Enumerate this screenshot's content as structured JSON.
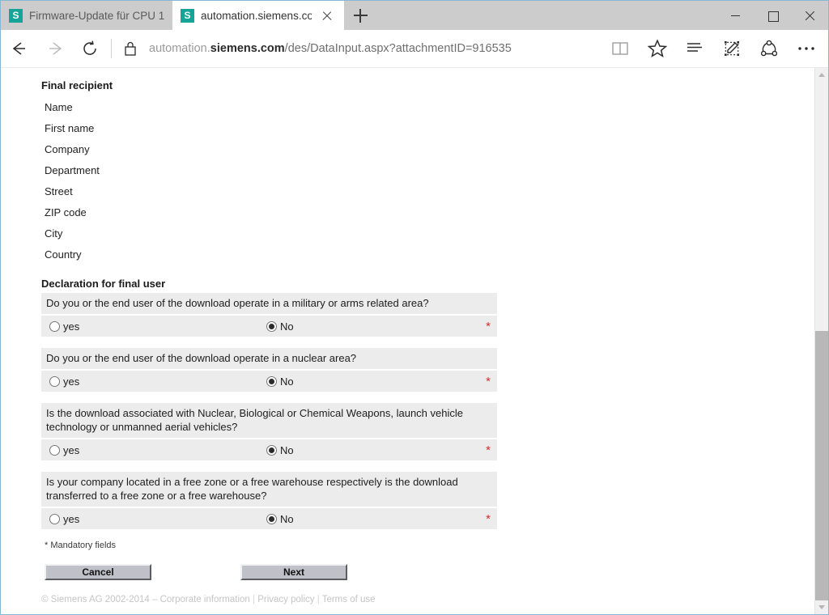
{
  "browser": {
    "tabs": [
      {
        "favicon_letter": "S",
        "title": "Firmware-Update für CPU 1",
        "active": false
      },
      {
        "favicon_letter": "S",
        "title": "automation.siemens.cor",
        "active": true
      }
    ],
    "new_tab_label": "+",
    "window_controls": {
      "minimize": "Minimize",
      "maximize": "Maximize",
      "close": "Close"
    },
    "toolbar": {
      "back_label": "Back",
      "forward_label": "Forward",
      "refresh_label": "Refresh",
      "security_label": "Secure connection",
      "url_host": "automation.",
      "url_domain": "siemens.com",
      "url_path": "/des/DataInput.aspx?attachmentID=916535",
      "reading_view_label": "Reading view",
      "web_note_label": "Make a Web Note",
      "share_label": "Share",
      "more_label": "More"
    }
  },
  "page": {
    "recipient": {
      "heading": "Final recipient",
      "fields": [
        {
          "label": "Name"
        },
        {
          "label": "First name"
        },
        {
          "label": "Company"
        },
        {
          "label": "Department"
        },
        {
          "label": "Street"
        },
        {
          "label": "ZIP code"
        },
        {
          "label": "City"
        },
        {
          "label": "Country"
        }
      ]
    },
    "declaration": {
      "heading": "Declaration for final user",
      "yes_label": "yes",
      "no_label": "No",
      "required_marker": "*",
      "questions": [
        {
          "text": "Do you or the end user of the download operate in a military or arms related area?",
          "selected": "No"
        },
        {
          "text": "Do you or the end user of the download operate in a nuclear area?",
          "selected": "No"
        },
        {
          "text": "Is the download associated with Nuclear, Biological or Chemical Weapons, launch vehicle technology or unmanned aerial vehicles?",
          "selected": "No"
        },
        {
          "text": "Is your company located in a free zone or a free warehouse respectively is the download transferred to a free zone or a free warehouse?",
          "selected": "No"
        }
      ]
    },
    "mandatory_note": "* Mandatory fields",
    "buttons": {
      "cancel": "Cancel",
      "next": "Next"
    },
    "footer": {
      "copyright": "© Siemens AG 2002-2014 – ",
      "corporate_information": "Corporate information",
      "privacy_policy": "Privacy policy",
      "terms_of_use": "Terms of use",
      "separator": " | "
    }
  },
  "colors": {
    "accent_teal": "#16a398",
    "required_red": "#d42c2c",
    "row_gray": "#ececec",
    "tabstrip_gray": "#cccccc"
  }
}
